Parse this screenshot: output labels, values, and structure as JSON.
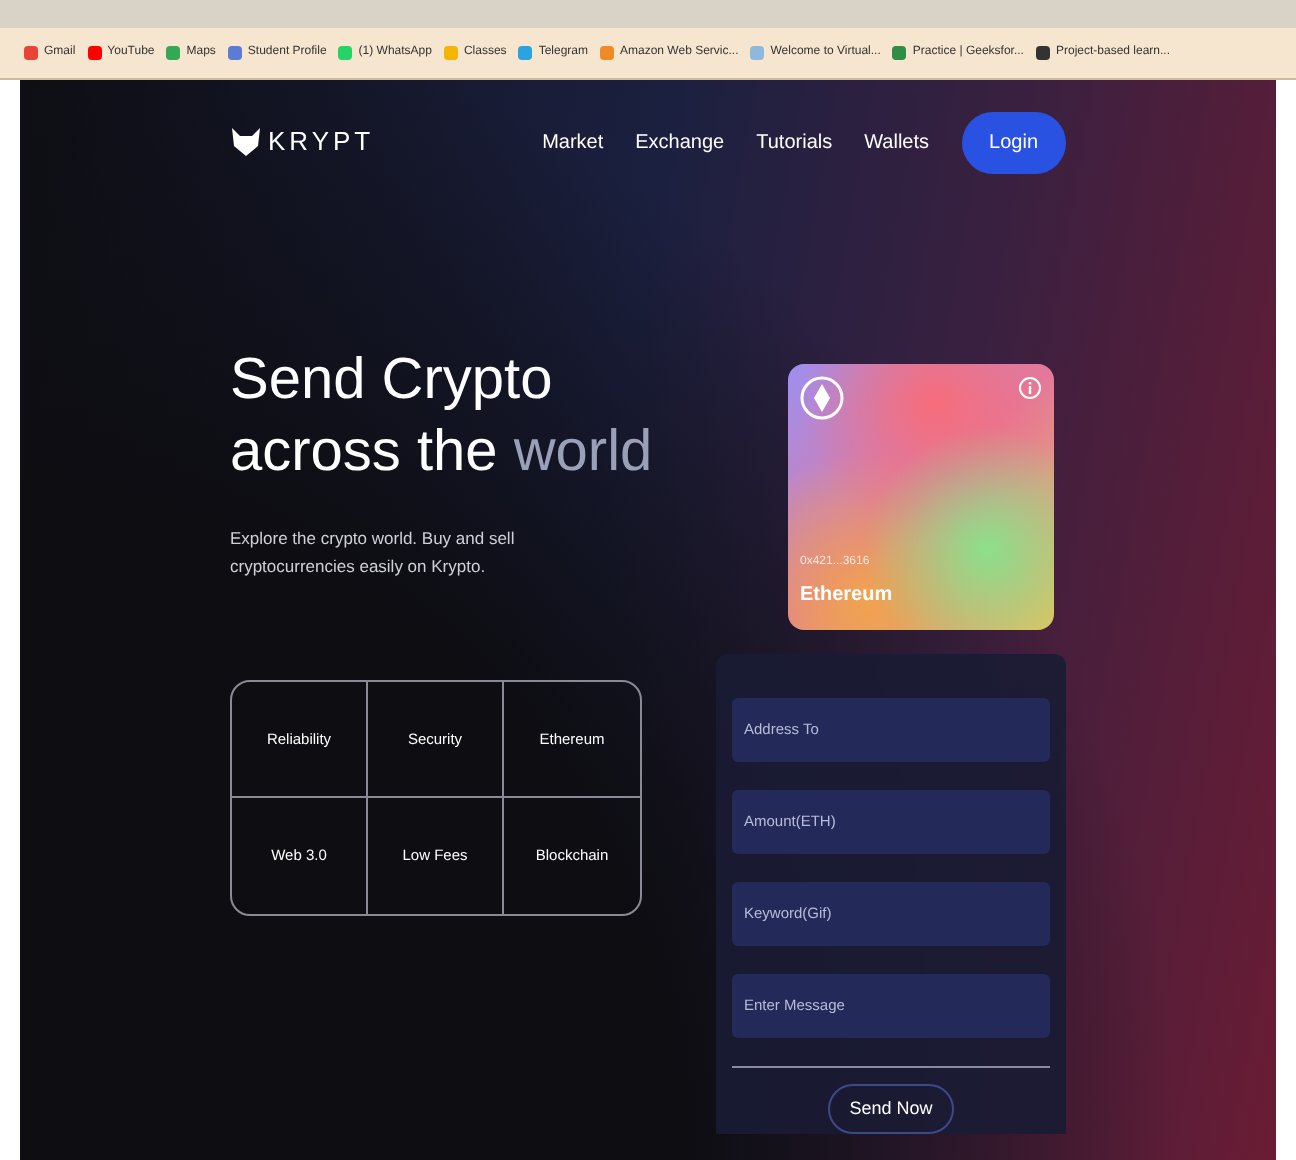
{
  "bookmarks": [
    {
      "label": "Gmail",
      "color": "#ea4335"
    },
    {
      "label": "YouTube",
      "color": "#ff0000"
    },
    {
      "label": "Maps",
      "color": "#34a853"
    },
    {
      "label": "Student Profile",
      "color": "#5b7bd5"
    },
    {
      "label": "(1) WhatsApp",
      "color": "#25d366"
    },
    {
      "label": "Classes",
      "color": "#f4b400"
    },
    {
      "label": "Telegram",
      "color": "#2aa3e0"
    },
    {
      "label": "Amazon Web Servic...",
      "color": "#f08a24"
    },
    {
      "label": "Welcome to Virtual...",
      "color": "#8fb8de"
    },
    {
      "label": "Practice | Geeksfor...",
      "color": "#2f8d46"
    },
    {
      "label": "Project-based learn...",
      "color": "#333333"
    }
  ],
  "nav": {
    "logo": "KRYPT",
    "links": [
      "Market",
      "Exchange",
      "Tutorials",
      "Wallets"
    ],
    "login": "Login"
  },
  "hero": {
    "title_line1": "Send Crypto",
    "title_line2_a": "across the ",
    "title_line2_b": "world",
    "subtitle": "Explore the crypto world. Buy and sell cryptocurrencies easily on Krypto."
  },
  "features": [
    "Reliability",
    "Security",
    "Ethereum",
    "Web 3.0",
    "Low Fees",
    "Blockchain"
  ],
  "card": {
    "address": "0x421...3616",
    "network": "Ethereum"
  },
  "form": {
    "fields": [
      {
        "placeholder": "Address To"
      },
      {
        "placeholder": "Amount(ETH)"
      },
      {
        "placeholder": "Keyword(Gif)"
      },
      {
        "placeholder": "Enter Message"
      }
    ],
    "submit": "Send Now"
  }
}
